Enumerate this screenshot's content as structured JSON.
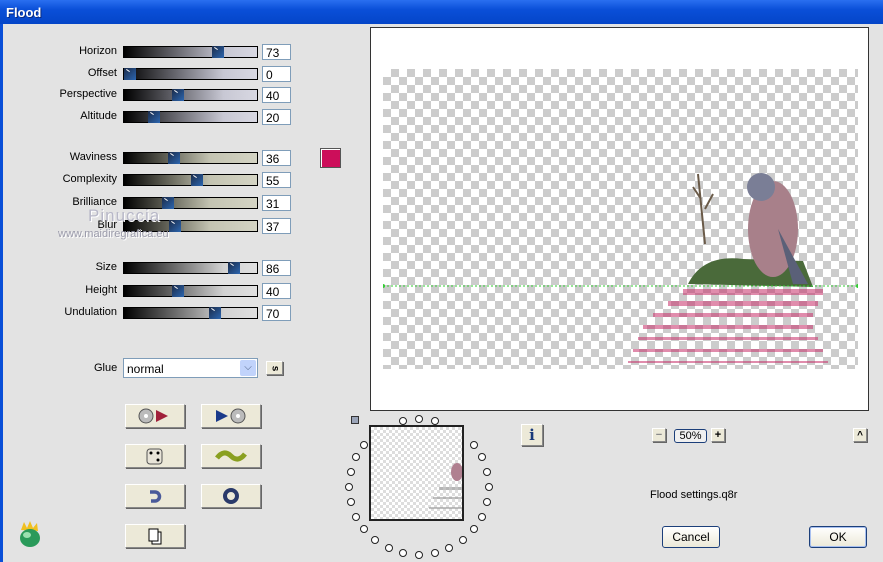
{
  "window": {
    "title": "Flood"
  },
  "sliders": [
    {
      "label": "Horizon",
      "value": "73",
      "group": 1
    },
    {
      "label": "Offset",
      "value": "0",
      "group": 1
    },
    {
      "label": "Perspective",
      "value": "40",
      "group": 1
    },
    {
      "label": "Altitude",
      "value": "20",
      "group": 1
    },
    {
      "label": "Waviness",
      "value": "36",
      "group": 2
    },
    {
      "label": "Complexity",
      "value": "55",
      "group": 2
    },
    {
      "label": "Brilliance",
      "value": "31",
      "group": 2
    },
    {
      "label": "Blur",
      "value": "37",
      "group": 2
    },
    {
      "label": "Size",
      "value": "86",
      "group": 3
    },
    {
      "label": "Height",
      "value": "40",
      "group": 3
    },
    {
      "label": "Undulation",
      "value": "70",
      "group": 3
    }
  ],
  "color_swatch": "#cc0e5a",
  "watermark": {
    "name": "Pinuccia",
    "url": "www.maidiregrafica.eu"
  },
  "glue": {
    "label": "Glue",
    "value": "normal",
    "s_button": "s"
  },
  "buttons": [
    "load-preset-icon",
    "save-preset-icon",
    "random-dice-icon",
    "wave-icon",
    "undo-icon",
    "reset-ring-icon",
    "copy-icon"
  ],
  "preview": {
    "zoom": "50%",
    "zoom_minus": "−",
    "zoom_plus": "+",
    "collapse": "^",
    "info": "i"
  },
  "settings_file": "Flood settings.q8r",
  "actions": {
    "cancel": "Cancel",
    "ok": "OK"
  }
}
